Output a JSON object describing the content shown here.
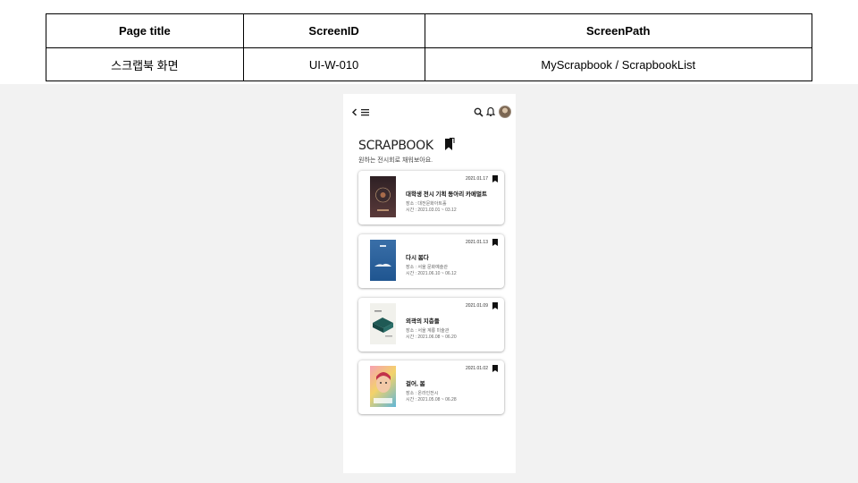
{
  "spec": {
    "headers": [
      "Page title",
      "ScreenID",
      "ScreenPath"
    ],
    "values": [
      "스크랩북 화면",
      "UI-W-010",
      "MyScrapbook / ScrapbookList"
    ]
  },
  "app": {
    "title": "SCRAPBOOK",
    "subtitle": "원하는 전시회로 채워보아요.",
    "icons": [
      "back-icon",
      "menu-icon",
      "search-icon",
      "bell-icon",
      "avatar",
      "bookmark-icon"
    ]
  },
  "cards": [
    {
      "date": "2021.01.17",
      "title": "대학생 전시 기획 동아리 카메멀트",
      "place": "장소 : 대전문화아트홀",
      "time": "시간 : 2021.03.01 ~ 03.12"
    },
    {
      "date": "2021.01.13",
      "title": "다시 봄다",
      "place": "장소 : 서울 문화예술관",
      "time": "시간 : 2021.06.10 ~ 06.12"
    },
    {
      "date": "2021.01.09",
      "title": "외곽의 지층들",
      "place": "장소 : 서울 계룡 미술관",
      "time": "시간 : 2021.06.08 ~ 06.20"
    },
    {
      "date": "2021.01.02",
      "title": "걸어, 봄",
      "place": "장소 : 온라인전시",
      "time": "시간 : 2021.05.08 ~ 06.28"
    }
  ],
  "colors": {
    "stage": "#f2f2f2",
    "text": "#222222"
  }
}
